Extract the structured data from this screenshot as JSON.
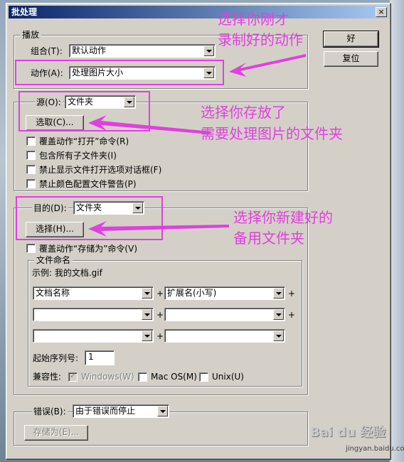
{
  "dialog": {
    "title": "批处理",
    "close_label": "×",
    "ok_label": "好",
    "reset_label": "复位"
  },
  "play": {
    "legend": "播放",
    "set_label": "组合(T):",
    "set_value": "默认动作",
    "action_label": "动作(A):",
    "action_value": "处理图片大小"
  },
  "source": {
    "label": "源(O):",
    "value": "文件夹",
    "choose_label": "选取(C)...",
    "options": [
      "覆盖动作“打开”命令(R)",
      "包含所有子文件夹(I)",
      "禁止显示文件打开选项对话框(F)",
      "禁止颜色配置文件警告(P)"
    ]
  },
  "destination": {
    "label": "目的(D):",
    "value": "文件夹",
    "choose_label": "选择(H)...",
    "override_save": "覆盖动作“存储为”命令(V)",
    "naming": {
      "legend": "文件命名",
      "example": "示例: 我的文档.gif",
      "rows": [
        [
          "文档名称",
          "扩展名(小写)"
        ],
        [
          "",
          ""
        ],
        [
          "",
          ""
        ]
      ],
      "plus": "+",
      "serial_label": "起始序列号:",
      "serial_value": "1",
      "compat_label": "兼容性:",
      "compat": [
        {
          "label": "Windows(W)",
          "checked": true,
          "disabled": true
        },
        {
          "label": "Mac OS(M)",
          "checked": false,
          "disabled": false
        },
        {
          "label": "Unix(U)",
          "checked": false,
          "disabled": false
        }
      ]
    }
  },
  "errors": {
    "label": "错误(B):",
    "value": "由于错误而停止",
    "save_as_label": "存储为(E)..."
  },
  "annotations": {
    "a1_line1": "选择你刚才",
    "a1_line2": "录制好的动作",
    "a2_line1": "选择你存放了",
    "a2_line2": "需要处理图片的文件夹",
    "a3_line1": "选择你新建好的",
    "a3_line2": "备用文件夹"
  },
  "watermark": {
    "brand": "Bai du 经验",
    "url": "jingyan.baidu.com"
  },
  "colors": {
    "annotation": "#e040e0",
    "dialog_face": "#d4d0c8",
    "title_start": "#0a246a"
  }
}
